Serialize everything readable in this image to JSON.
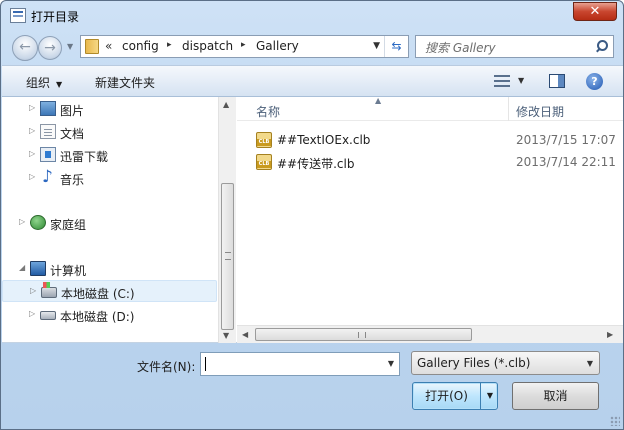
{
  "window": {
    "title": "打开目录",
    "close_label": "✕"
  },
  "nav": {
    "back_glyph": "←",
    "forward_glyph": "→"
  },
  "address": {
    "lead": "«",
    "crumbs": [
      "config",
      "dispatch",
      "Gallery"
    ],
    "separator": "▸"
  },
  "search": {
    "placeholder": "搜索 Gallery"
  },
  "toolbar": {
    "organize_label": "组织",
    "new_folder_label": "新建文件夹",
    "help_label": "?"
  },
  "sidebar": {
    "items": [
      {
        "label": "图片",
        "icon": "pictures-icon"
      },
      {
        "label": "文档",
        "icon": "documents-icon"
      },
      {
        "label": "迅雷下载",
        "icon": "downloads-icon"
      },
      {
        "label": "音乐",
        "icon": "music-icon"
      },
      {
        "label": "家庭组",
        "icon": "homegroup-icon"
      },
      {
        "label": "计算机",
        "icon": "computer-icon"
      },
      {
        "label": "本地磁盘 (C:)",
        "icon": "drive-c-icon",
        "selected": true
      },
      {
        "label": "本地磁盘 (D:)",
        "icon": "drive-d-icon"
      }
    ]
  },
  "columns": {
    "name": "名称",
    "modified": "修改日期"
  },
  "files": [
    {
      "name": "##TextIOEx.clb",
      "modified": "2013/7/15 17:07"
    },
    {
      "name": "##传送带.clb",
      "modified": "2013/7/14 22:11"
    }
  ],
  "footer": {
    "filename_label": "文件名(N):",
    "filename_value": "",
    "filter_value": "Gallery Files (*.clb)",
    "open_label": "打开(O)",
    "cancel_label": "取消"
  },
  "colors": {
    "accent": "#3c7fb1",
    "selection": "#e5f1fb",
    "close": "#c9462f"
  }
}
